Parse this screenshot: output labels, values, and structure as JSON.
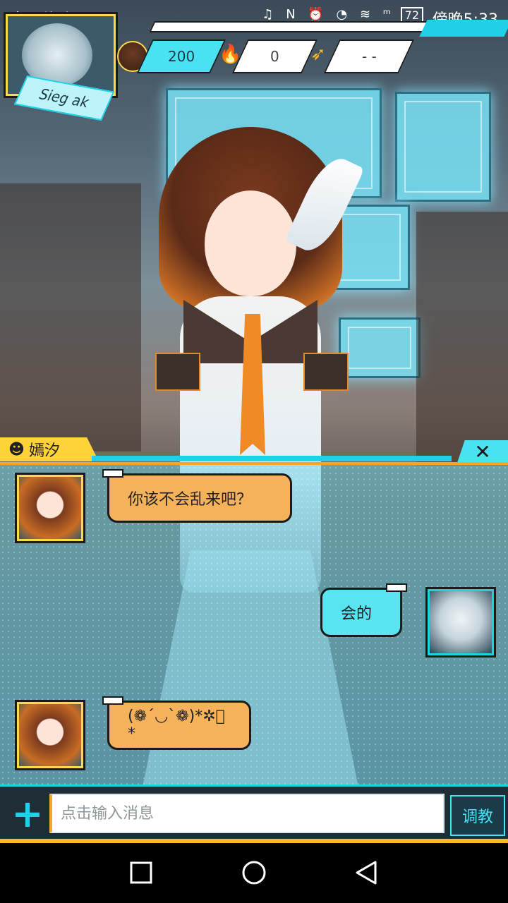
{
  "status_bar": {
    "carrier": "中国移动",
    "icons": "♫ N ⏰ ◔ ≋ ᵐ",
    "battery": "72",
    "time": "傍晚5:33"
  },
  "player": {
    "name": "Sieg ak",
    "stats": [
      {
        "icon": "heart-wing-icon",
        "value": "200"
      },
      {
        "icon": "fire-icon",
        "value": "0"
      },
      {
        "icon": "wing-icon",
        "value": "- -"
      }
    ]
  },
  "npc": {
    "name": "嫣汐"
  },
  "messages": [
    {
      "from": "npc",
      "text": "你该不会乱来吧？"
    },
    {
      "from": "user",
      "text": "会的"
    },
    {
      "from": "npc",
      "text": "(❁´◡`❁)*✲ﾟ*"
    }
  ],
  "input": {
    "placeholder": "点击输入消息",
    "send_label": "调教"
  },
  "colors": {
    "accent": "#1fd0e6",
    "gold": "#ffd94a",
    "npc_bubble": "#f5b25a",
    "user_bubble": "#59e4f2"
  }
}
